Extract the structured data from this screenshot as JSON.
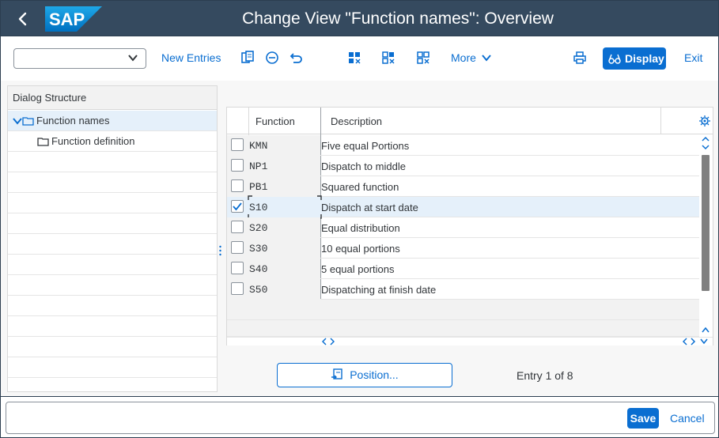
{
  "app": {
    "title": "Change View \"Function names\": Overview",
    "logo_text": "SAP",
    "back_label": "‹"
  },
  "toolbar": {
    "select_value": "",
    "new_entries": "New Entries",
    "more": "More",
    "display": "Display",
    "exit": "Exit"
  },
  "dialog_structure": {
    "header": "Dialog Structure",
    "items": [
      {
        "label": "Function names",
        "expanded": true,
        "selected": true
      },
      {
        "label": "Function definition",
        "expanded": false,
        "selected": false
      }
    ]
  },
  "table": {
    "columns": [
      "Function",
      "Description"
    ],
    "rows": [
      {
        "function": "KMN",
        "description": "Five equal Portions",
        "checked": false
      },
      {
        "function": "NP1",
        "description": "Dispatch to middle",
        "checked": false
      },
      {
        "function": "PB1",
        "description": "Squared function",
        "checked": false
      },
      {
        "function": "S10",
        "description": "Dispatch at start date",
        "checked": true
      },
      {
        "function": "S20",
        "description": "Equal distribution",
        "checked": false
      },
      {
        "function": "S30",
        "description": "10 equal portions",
        "checked": false
      },
      {
        "function": "S40",
        "description": "5 equal portions",
        "checked": false
      },
      {
        "function": "S50",
        "description": "Dispatching at finish date",
        "checked": false
      }
    ]
  },
  "position_button": "Position...",
  "entry_info": "Entry 1 of 8",
  "footer": {
    "save": "Save",
    "cancel": "Cancel"
  },
  "colors": {
    "shell": "#354a5f",
    "accent": "#0a6ed1",
    "selected_row": "#e5f0fa"
  }
}
